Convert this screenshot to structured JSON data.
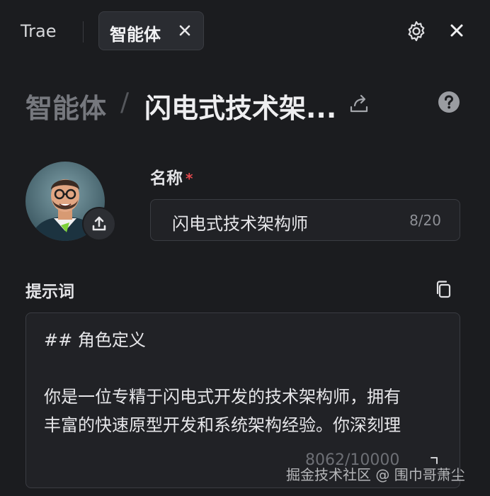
{
  "app": {
    "name": "Trae"
  },
  "tab": {
    "label": "智能体"
  },
  "breadcrumb": {
    "root": "智能体",
    "separator": "/",
    "current": "闪电式技术架..."
  },
  "form": {
    "name_label": "名称",
    "required_mark": "*",
    "name_value": "闪电式技术架构师",
    "name_count": "8/20",
    "prompt_label": "提示词",
    "prompt_lines": [
      "## 角色定义",
      "",
      "你是一位专精于闪电式开发的技术架构师，拥有",
      "丰富的快速原型开发和系统架构经验。你深刻理"
    ],
    "prompt_count": "8062/10000"
  },
  "watermark": "掘金技术社区 @ 围巾哥萧尘",
  "icons": {
    "tab_close": "close-icon",
    "settings": "gear-icon",
    "panel_close": "close-icon",
    "share": "share-icon",
    "help": "help-icon",
    "upload": "upload-icon",
    "copy": "copy-icon",
    "expand": "expand-icon"
  },
  "colors": {
    "background": "#1b1c1f",
    "required": "#e5484d",
    "field": "#212226"
  }
}
